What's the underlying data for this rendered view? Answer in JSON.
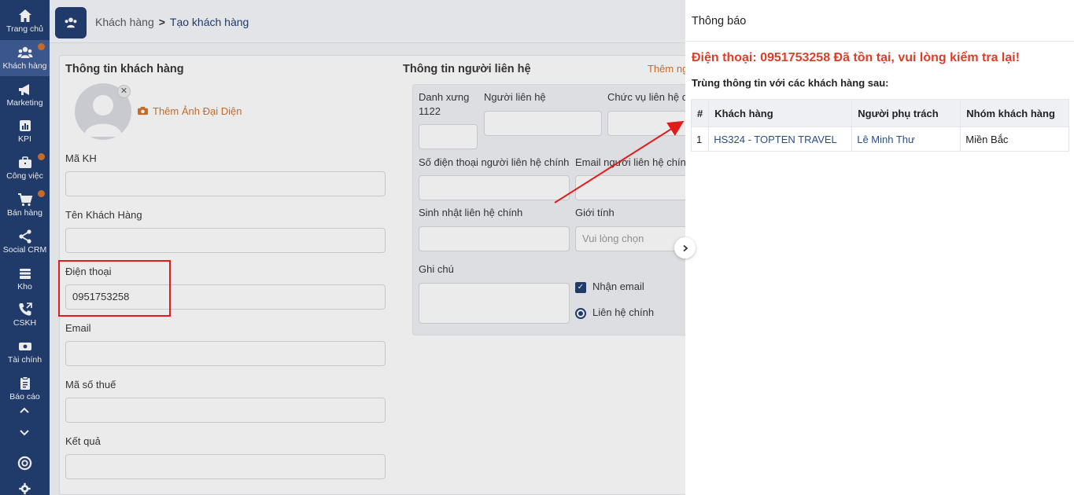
{
  "sidebar": {
    "items": [
      {
        "label": "Trang chủ",
        "icon": "home-icon",
        "dot": false
      },
      {
        "label": "Khách hàng",
        "icon": "users-icon",
        "dot": true
      },
      {
        "label": "Marketing",
        "icon": "megaphone-icon",
        "dot": false
      },
      {
        "label": "KPI",
        "icon": "chart-icon",
        "dot": false
      },
      {
        "label": "Công việc",
        "icon": "briefcase-icon",
        "dot": true
      },
      {
        "label": "Bán hàng",
        "icon": "cart-icon",
        "dot": true
      },
      {
        "label": "Social CRM",
        "icon": "share-icon",
        "dot": false
      },
      {
        "label": "Kho",
        "icon": "warehouse-icon",
        "dot": false
      },
      {
        "label": "CSKH",
        "icon": "phone-icon",
        "dot": false
      },
      {
        "label": "Tài chính",
        "icon": "money-icon",
        "dot": false
      },
      {
        "label": "Báo cáo",
        "icon": "clipboard-icon",
        "dot": false
      }
    ]
  },
  "breadcrumb": {
    "parent": "Khách hàng",
    "current": "Tạo khách hàng"
  },
  "customer": {
    "title": "Thông tin khách hàng",
    "add_avatar": "Thêm Ảnh Đại Diện",
    "code_label": "Mã KH",
    "name_label": "Tên Khách Hàng",
    "phone_label": "Điện thoại",
    "phone_value": "0951753258",
    "email_label": "Email",
    "tax_label": "Mã số thuế",
    "result_label": "Kết quả"
  },
  "contact": {
    "title": "Thông tin người liên hệ",
    "add_contact": "Thêm người",
    "salutation_label": "Danh xưng",
    "salutation_value": "1122",
    "person_label": "Người liên hệ",
    "position_label": "Chức vụ liên hệ chính",
    "phone_label": "Số điện thoại người liên hệ chính",
    "email_label": "Email người liên hệ chính",
    "birthday_label": "Sinh nhật liên hệ chính",
    "gender_label": "Giới tính",
    "gender_placeholder": "Vui lòng chọn",
    "note_label": "Ghi chú",
    "receive_email": "Nhận email",
    "primary_contact": "Liên hệ chính"
  },
  "panel": {
    "title": "Thông báo",
    "error": "Điện thoại: 0951753258 Đã tồn tại, vui lòng kiểm tra lại!",
    "subtitle": "Trùng thông tin với các khách hàng sau:",
    "columns": [
      "#",
      "Khách hàng",
      "Người phụ trách",
      "Nhóm khách hàng"
    ],
    "rows": [
      {
        "num": "1",
        "customer": "HS324 - TOPTEN TRAVEL",
        "owner": "Lê Minh Thư",
        "group": "Miền Bắc"
      }
    ]
  },
  "colors": {
    "brand": "#1e3a6e",
    "accent": "#d4712a",
    "error": "#d9402a",
    "annotation": "#e31b1b"
  }
}
